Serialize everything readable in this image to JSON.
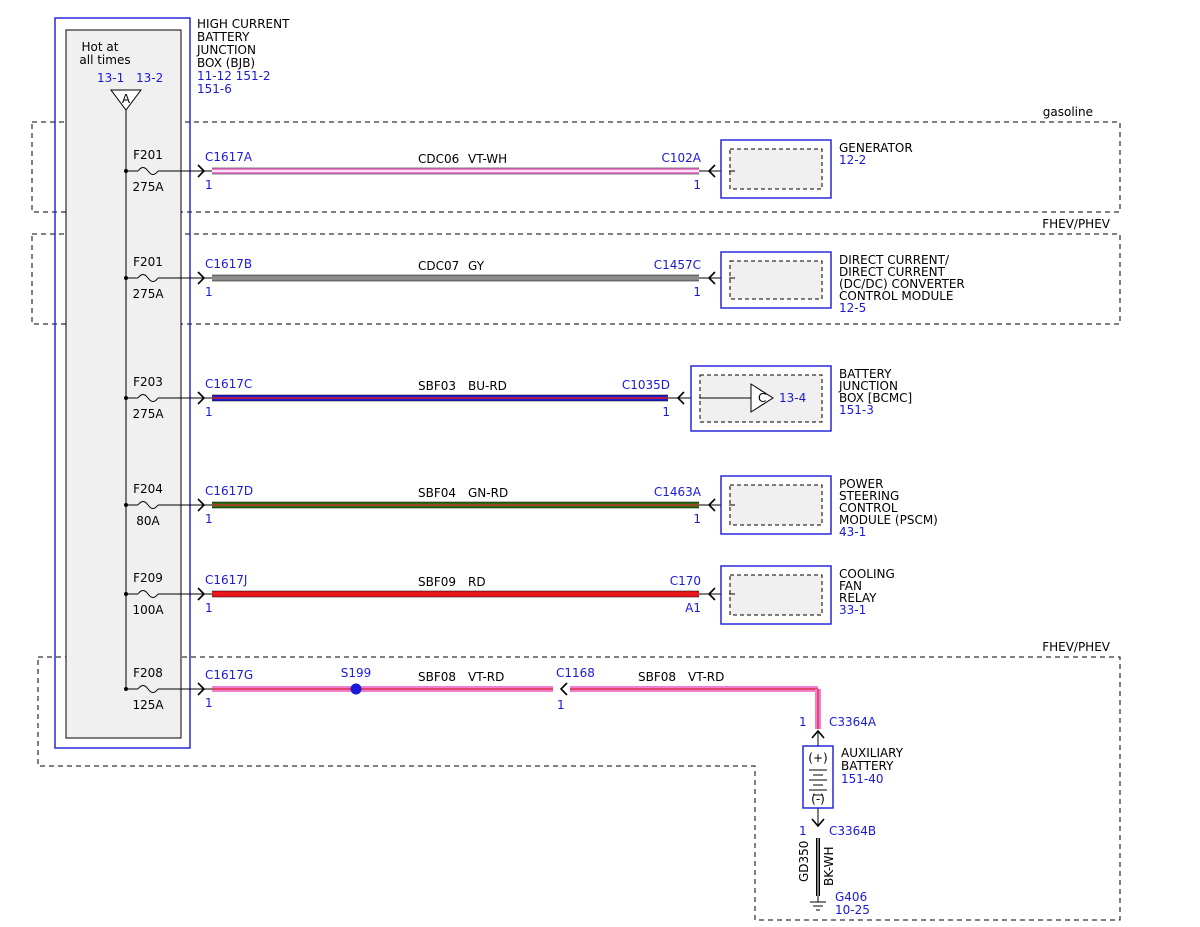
{
  "bjb": {
    "title_lines": [
      "HIGH CURRENT",
      "BATTERY",
      "JUNCTION",
      "BOX (BJB)"
    ],
    "refs": [
      "11-12  151-2",
      "151-6"
    ],
    "hot_lines": [
      "Hot at",
      "all times"
    ],
    "hot_refs": [
      "13-1",
      "13-2"
    ],
    "bus_symbol": "A"
  },
  "regions": [
    {
      "label": "gasoline"
    },
    {
      "label": "FHEV/PHEV"
    },
    {
      "label": "FHEV/PHEV"
    }
  ],
  "circuits": [
    {
      "fuse": "F201",
      "rating": "275A",
      "conn_left": "C1617A",
      "pin_left": "1",
      "circuit": "CDC06",
      "color_code": "VT-WH",
      "conn_right": "C102A",
      "pin_right": "1",
      "component": [
        "GENERATOR"
      ],
      "ref": "12-2",
      "wire_main": "#ef7fd0",
      "wire_stripe": "#ffffff"
    },
    {
      "fuse": "F201",
      "rating": "275A",
      "conn_left": "C1617B",
      "pin_left": "1",
      "circuit": "CDC07",
      "color_code": "GY",
      "conn_right": "C1457C",
      "pin_right": "1",
      "component": [
        "DIRECT CURRENT/",
        "DIRECT CURRENT",
        "(DC/DC) CONVERTER",
        "CONTROL MODULE"
      ],
      "ref": "12-5",
      "wire_main": "#8a8a8a",
      "wire_stripe": ""
    },
    {
      "fuse": "F203",
      "rating": "275A",
      "conn_left": "C1617C",
      "pin_left": "1",
      "circuit": "SBF03",
      "color_code": "BU-RD",
      "conn_right": "C1035D",
      "pin_right": "1",
      "component": [
        "BATTERY",
        "JUNCTION",
        "BOX [BCMC]"
      ],
      "ref": "151-3",
      "inner_symbol": "C",
      "inner_ref": "13-4",
      "wire_main": "#1e1ecf",
      "wire_stripe": "#e01a1a"
    },
    {
      "fuse": "F204",
      "rating": "80A",
      "conn_left": "C1617D",
      "pin_left": "1",
      "circuit": "SBF04",
      "color_code": "GN-RD",
      "conn_right": "C1463A",
      "pin_right": "1",
      "component": [
        "POWER",
        "STEERING",
        "CONTROL",
        "MODULE (PSCM)"
      ],
      "ref": "43-1",
      "wire_main": "#2e6b12",
      "wire_stripe": "#c0392b"
    },
    {
      "fuse": "F209",
      "rating": "100A",
      "conn_left": "C1617J",
      "pin_left": "1",
      "circuit": "SBF09",
      "color_code": "RD",
      "conn_right": "C170",
      "pin_right": "A1",
      "component": [
        "COOLING",
        "FAN",
        "RELAY"
      ],
      "ref": "33-1",
      "wire_main": "#e8161b",
      "wire_stripe": ""
    },
    {
      "fuse": "F208",
      "rating": "125A",
      "conn_left": "C1617G",
      "pin_left": "1",
      "splice": "S199",
      "circuit": "SBF08",
      "color_code": "VT-RD",
      "conn_mid": "C1168",
      "pin_mid": "1",
      "circuit2": "SBF08",
      "color_code2": "VT-RD",
      "wire_main": "#ef7fd0",
      "wire_stripe": "#e0304a"
    }
  ],
  "aux": {
    "conn_top": "C3364A",
    "pin_top": "1",
    "component": [
      "AUXILIARY",
      "BATTERY"
    ],
    "ref": "151-40",
    "plus": "(+)",
    "minus": "(-)",
    "conn_bottom": "C3364B",
    "pin_bottom": "1",
    "ground_circuit": "GD350",
    "ground_color": "BK-WH",
    "ground": "G406",
    "ground_ref": "10-25"
  },
  "colors": {
    "blue": "#1a1ad6",
    "box_fill": "#f0f0f0",
    "black": "#000000"
  }
}
